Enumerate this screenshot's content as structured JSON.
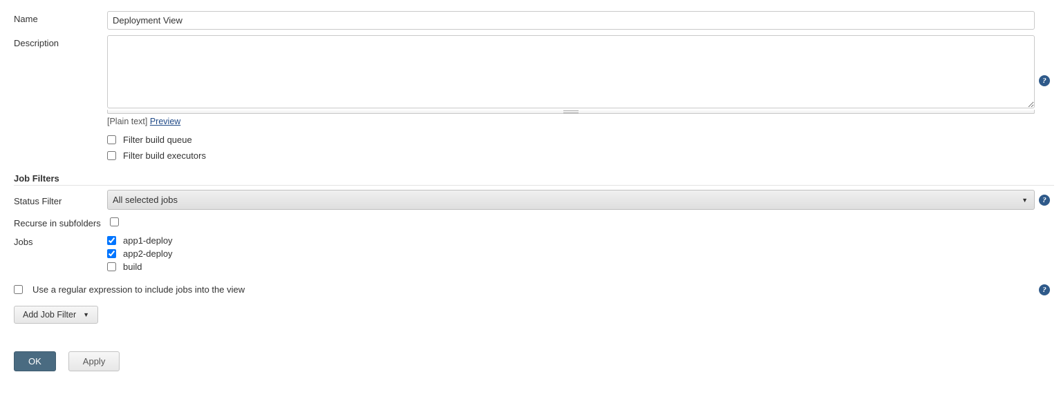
{
  "labels": {
    "name": "Name",
    "description": "Description",
    "plain_text_prefix": "[Plain text] ",
    "preview_link": "Preview",
    "filter_build_queue": "Filter build queue",
    "filter_build_executors": "Filter build executors",
    "section_job_filters": "Job Filters",
    "status_filter": "Status Filter",
    "recurse": "Recurse in subfolders",
    "jobs": "Jobs",
    "regex_line": "Use a regular expression to include jobs into the view",
    "add_job_filter": "Add Job Filter",
    "ok": "OK",
    "apply": "Apply"
  },
  "values": {
    "name": "Deployment View",
    "description": "",
    "filter_build_queue_checked": false,
    "filter_build_executors_checked": false,
    "status_filter_selected": "All selected jobs",
    "recurse_checked": false,
    "regex_checked": false
  },
  "jobs": [
    {
      "label": "app1-deploy",
      "checked": true
    },
    {
      "label": "app2-deploy",
      "checked": true
    },
    {
      "label": "build",
      "checked": false
    }
  ]
}
